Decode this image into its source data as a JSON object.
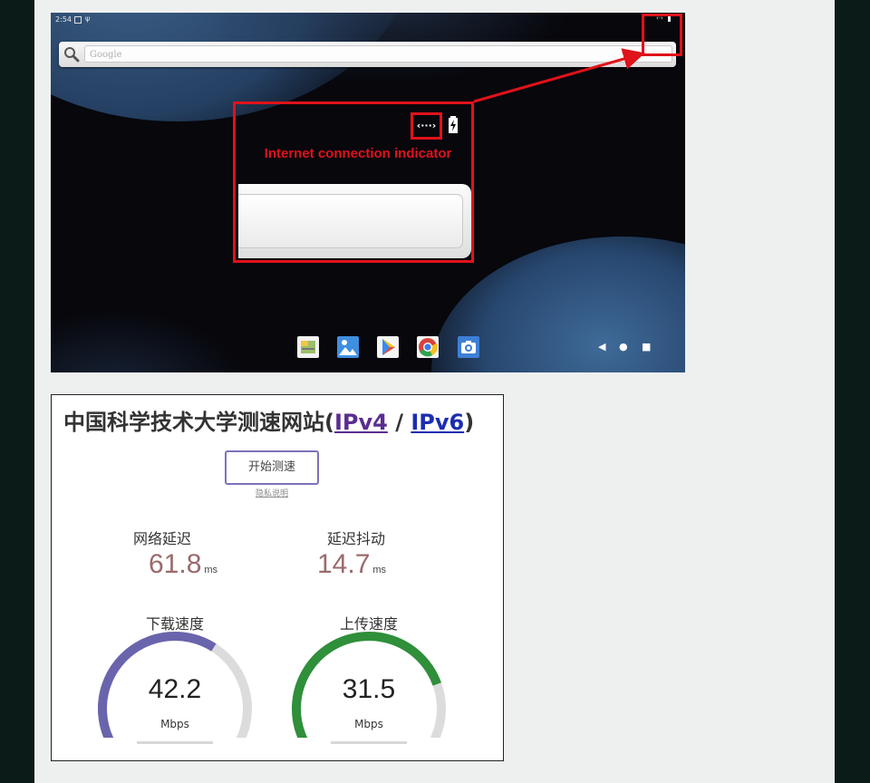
{
  "android": {
    "status_time": "2:54",
    "search_placeholder": "Google",
    "annotation_caption": "Internet connection indicator",
    "net_glyph": "‹···›",
    "dock_icons": [
      "gallery-widget-icon",
      "photos-icon",
      "play-store-icon",
      "chrome-icon",
      "camera-icon"
    ],
    "nav_buttons": [
      "◀",
      "●",
      "■"
    ],
    "colors": {
      "highlight": "#e0121a",
      "wallpaper": "#07070c"
    }
  },
  "speedtest": {
    "title_prefix": "中国科学技术大学测速网站(",
    "ipv4_link": "IPv4",
    "separator": " / ",
    "ipv6_link": "IPv6",
    "title_suffix": ")",
    "start_button": "开始测速",
    "privacy_link": "隐私说明",
    "latency": {
      "label": "网络延迟",
      "value": "61.8",
      "unit": "ms"
    },
    "jitter": {
      "label": "延迟抖动",
      "value": "14.7",
      "unit": "ms"
    },
    "download": {
      "label": "下载速度",
      "value": "42.2",
      "unit": "Mbps",
      "fill_fraction": 0.62,
      "color": "#6a64ad"
    },
    "upload": {
      "label": "上传速度",
      "value": "31.5",
      "unit": "Mbps",
      "fill_fraction": 0.76,
      "color": "#2f8f3a"
    }
  }
}
